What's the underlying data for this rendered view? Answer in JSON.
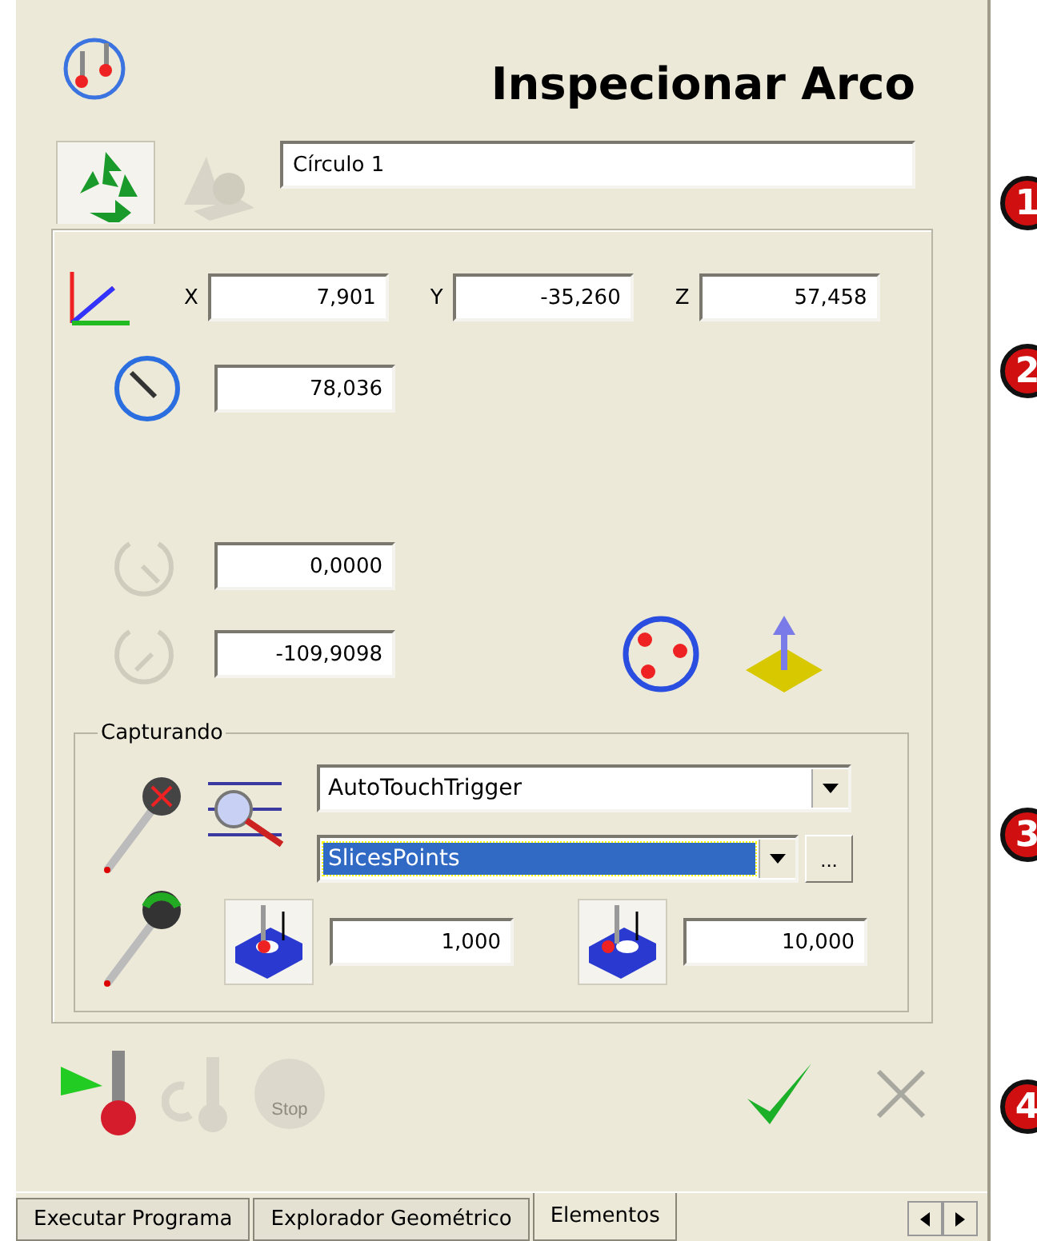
{
  "dialog": {
    "title": "Inspecionar Arco"
  },
  "name_field": {
    "value": "Círculo 1"
  },
  "name_buttons": [
    {
      "kind": "recycle",
      "pressed": true,
      "disabled": false
    },
    {
      "kind": "shapes",
      "pressed": false,
      "disabled": true
    }
  ],
  "coordinates": [
    {
      "label": "X",
      "value": "7,901"
    },
    {
      "label": "Y",
      "value": "-35,260"
    },
    {
      "label": "Z",
      "value": "57,458"
    }
  ],
  "radius": {
    "value": "78,036"
  },
  "angles": [
    {
      "value": "0,0000",
      "disabled": true
    },
    {
      "value": "-109,9098",
      "disabled": true
    }
  ],
  "capture": {
    "title": "Capturando",
    "mode": {
      "value": "AutoTouchTrigger",
      "selected": false
    },
    "strategy": {
      "value": "SlicesPoints",
      "selected": true
    },
    "more_button": "...",
    "depths": [
      {
        "value": "1,000"
      },
      {
        "value": "10,000"
      }
    ]
  },
  "actions": [
    {
      "kind": "run",
      "disabled": false
    },
    {
      "kind": "step",
      "disabled": true
    },
    {
      "kind": "stop",
      "label": "Stop",
      "disabled": true
    }
  ],
  "confirm": [
    {
      "kind": "ok",
      "disabled": false
    },
    {
      "kind": "cancel",
      "disabled": true
    }
  ],
  "tabs": [
    {
      "label": "Executar Programa",
      "selected": false
    },
    {
      "label": "Explorador Geométrico",
      "selected": false
    },
    {
      "label": "Elementos",
      "selected": true
    }
  ],
  "callouts": [
    {
      "label": "1"
    },
    {
      "label": "2"
    },
    {
      "label": "3"
    },
    {
      "label": "4"
    }
  ]
}
